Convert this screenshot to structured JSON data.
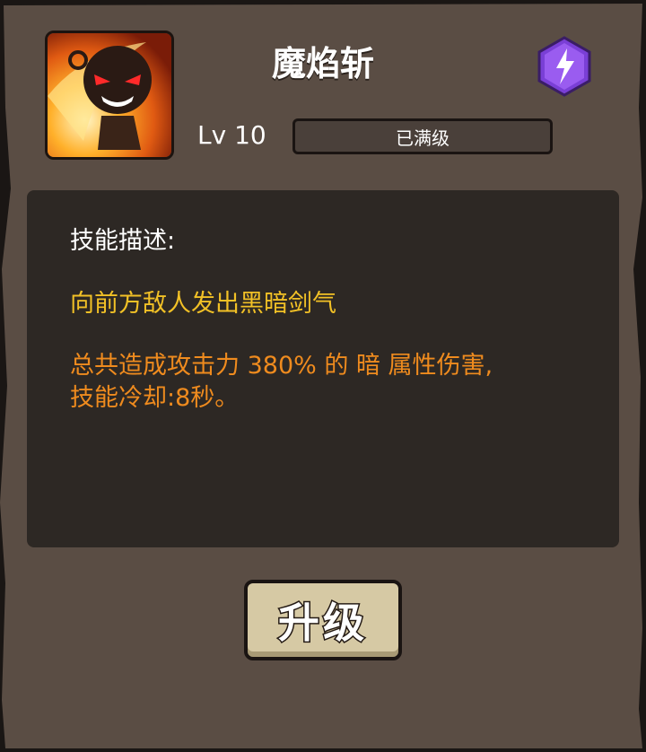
{
  "skill": {
    "name": "魔焰斩",
    "icon": "dark-flame-slash-character-icon",
    "element_icon": "lightning-hexagon-icon",
    "element_color": "#7a3fd6"
  },
  "level": {
    "label": "Lv 10",
    "status": "已满级"
  },
  "description": {
    "heading": "技能描述:",
    "line1": "向前方敌人发出黑暗剑气",
    "line2": "总共造成攻击力 380% 的 暗 属性伤害,",
    "line3": "技能冷却:8秒。",
    "colors": {
      "line1": "#f2c126",
      "line2": "#ef8b1e"
    }
  },
  "actions": {
    "upgrade_label": "升级"
  }
}
